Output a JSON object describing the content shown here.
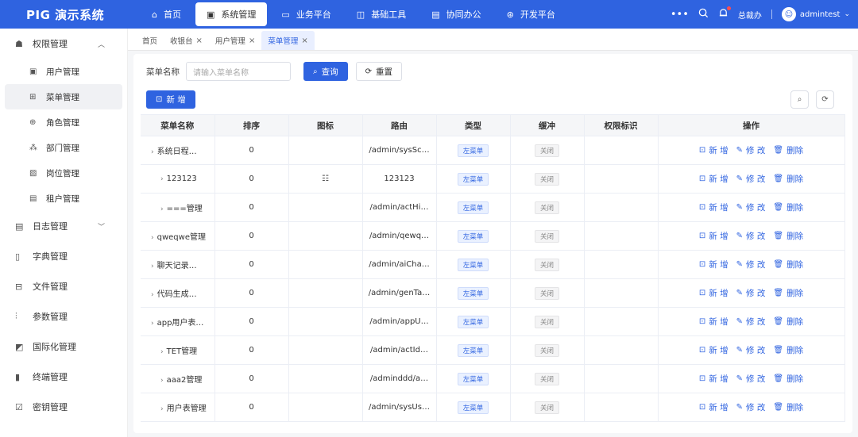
{
  "app": {
    "title": "PIG 演示系统"
  },
  "topnav": [
    {
      "label": "首页",
      "icon": "home-icon",
      "glyph": "⌂",
      "active": false
    },
    {
      "label": "系统管理",
      "icon": "system-icon",
      "glyph": "▣",
      "active": true
    },
    {
      "label": "业务平台",
      "icon": "monitor-icon",
      "glyph": "▭",
      "active": false
    },
    {
      "label": "基础工具",
      "icon": "briefcase-icon",
      "glyph": "◫",
      "active": false
    },
    {
      "label": "协同办公",
      "icon": "chat-icon",
      "glyph": "▤",
      "active": false
    },
    {
      "label": "开发平台",
      "icon": "code-icon",
      "glyph": "⊛",
      "active": false
    }
  ],
  "topright": {
    "tenant": "总裁办",
    "username": "admintest"
  },
  "sidebar": {
    "groups": [
      {
        "label": "权限管理",
        "icon": "permission-icon",
        "glyph": "☗",
        "expanded": true,
        "items": [
          {
            "label": "用户管理",
            "icon": "user-icon",
            "glyph": "▣",
            "active": false
          },
          {
            "label": "菜单管理",
            "icon": "menu-grid-icon",
            "glyph": "⊞",
            "active": true
          },
          {
            "label": "角色管理",
            "icon": "role-icon",
            "glyph": "⊕",
            "active": false
          },
          {
            "label": "部门管理",
            "icon": "dept-icon",
            "glyph": "⁂",
            "active": false
          },
          {
            "label": "岗位管理",
            "icon": "post-icon",
            "glyph": "▨",
            "active": false
          },
          {
            "label": "租户管理",
            "icon": "tenant-icon",
            "glyph": "▤",
            "active": false
          }
        ]
      },
      {
        "label": "日志管理",
        "icon": "log-icon",
        "glyph": "▤",
        "expanded": false,
        "items": []
      },
      {
        "label": "字典管理",
        "icon": "dict-icon",
        "glyph": "▯",
        "items": []
      },
      {
        "label": "文件管理",
        "icon": "file-icon",
        "glyph": "⊟",
        "items": []
      },
      {
        "label": "参数管理",
        "icon": "param-icon",
        "glyph": "⫶",
        "items": []
      },
      {
        "label": "国际化管理",
        "icon": "i18n-icon",
        "glyph": "◩",
        "items": []
      },
      {
        "label": "终端管理",
        "icon": "terminal-icon",
        "glyph": "▮",
        "items": []
      },
      {
        "label": "密钥管理",
        "icon": "key-icon",
        "glyph": "☑",
        "items": []
      }
    ]
  },
  "tabs": [
    {
      "label": "首页",
      "closable": false,
      "active": false
    },
    {
      "label": "收银台",
      "closable": true,
      "active": false
    },
    {
      "label": "用户管理",
      "closable": true,
      "active": false
    },
    {
      "label": "菜单管理",
      "closable": true,
      "active": true
    }
  ],
  "search": {
    "label": "菜单名称",
    "placeholder": "请输入菜单名称",
    "query_label": "查询",
    "reset_label": "重置"
  },
  "toolbar": {
    "add_label": "新 增"
  },
  "table": {
    "columns": [
      "菜单名称",
      "排序",
      "图标",
      "路由",
      "类型",
      "缓冲",
      "权限标识",
      "操作"
    ],
    "ops": {
      "add": "新 增",
      "edit": "修 改",
      "delete": "删除"
    },
    "rows": [
      {
        "name": "系统日程…",
        "indent": 0,
        "sort": "0",
        "icon": "",
        "route": "/admin/sysSc…",
        "type": "左菜单",
        "cache": "关闭",
        "perm": ""
      },
      {
        "name": "123123",
        "indent": 1,
        "sort": "0",
        "icon": "list-icon",
        "route": "123123",
        "type": "左菜单",
        "cache": "关闭",
        "perm": ""
      },
      {
        "name": "===管理",
        "indent": 1,
        "sort": "0",
        "icon": "",
        "route": "/admin/actHi…",
        "type": "左菜单",
        "cache": "关闭",
        "perm": ""
      },
      {
        "name": "qweqwe管理",
        "indent": 0,
        "sort": "0",
        "icon": "",
        "route": "/admin/qewq…",
        "type": "左菜单",
        "cache": "关闭",
        "perm": ""
      },
      {
        "name": "聊天记录…",
        "indent": 0,
        "sort": "0",
        "icon": "",
        "route": "/admin/aiCha…",
        "type": "左菜单",
        "cache": "关闭",
        "perm": ""
      },
      {
        "name": "代码生成…",
        "indent": 0,
        "sort": "0",
        "icon": "",
        "route": "/admin/genTa…",
        "type": "左菜单",
        "cache": "关闭",
        "perm": ""
      },
      {
        "name": "app用户表…",
        "indent": 0,
        "sort": "0",
        "icon": "",
        "route": "/admin/appU…",
        "type": "左菜单",
        "cache": "关闭",
        "perm": ""
      },
      {
        "name": "TET管理",
        "indent": 1,
        "sort": "0",
        "icon": "",
        "route": "/admin/actId…",
        "type": "左菜单",
        "cache": "关闭",
        "perm": ""
      },
      {
        "name": "aaa2管理",
        "indent": 1,
        "sort": "0",
        "icon": "",
        "route": "/adminddd/a…",
        "type": "左菜单",
        "cache": "关闭",
        "perm": ""
      },
      {
        "name": "用户表管理",
        "indent": 1,
        "sort": "0",
        "icon": "",
        "route": "/admin/sysUs…",
        "type": "左菜单",
        "cache": "关闭",
        "perm": ""
      }
    ]
  }
}
